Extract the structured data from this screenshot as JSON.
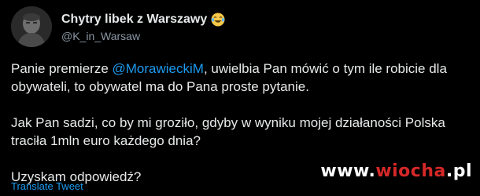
{
  "author": {
    "display_name": "Chytry libek z Warszawy",
    "emoji_icon": "face-with-tears-of-joy-icon",
    "handle": "@K_in_Warsaw"
  },
  "tweet": {
    "line1_prefix": "Panie premierze ",
    "mention": "@MorawieckiM",
    "line1_suffix": ", uwielbia Pan mówić o tym ile robicie dla",
    "line2": "obywateli, to obywatel ma do Pana proste pytanie.",
    "line3": "Jak Pan sadzi, co by mi groziło, gdyby w wyniku mojej działaności Polska",
    "line4": "traciła 1mln euro każdego dnia?",
    "line5": "Uzyskam odpowiedź?"
  },
  "translate_label": "Translate Tweet",
  "watermark": {
    "prefix": "www.",
    "accent": "wiocha",
    "suffix": ".pl"
  },
  "colors": {
    "background": "#000000",
    "text": "#e7e9ea",
    "muted": "#8b98a5",
    "link": "#1d9bf0",
    "watermark_accent": "#d62828"
  }
}
